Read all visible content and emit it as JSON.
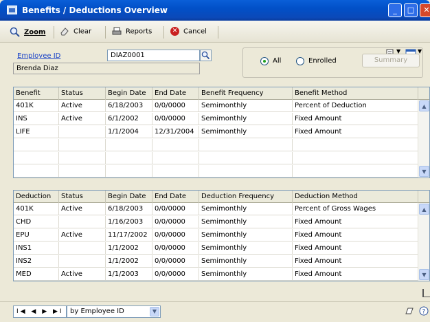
{
  "window": {
    "title": "Benefits / Deductions Overview",
    "buttons": [
      "_",
      "□",
      "✕"
    ]
  },
  "toolbar": {
    "zoom": "Zoom",
    "clear": "Clear",
    "reports": "Reports",
    "cancel": "Cancel"
  },
  "employee": {
    "label": "Employee ID",
    "id": "DIAZ0001",
    "name": "Brenda Diaz"
  },
  "filter": {
    "all": "All",
    "enrolled": "Enrolled",
    "selected": "All",
    "summary": "Summary"
  },
  "benefits": {
    "columns": [
      "Benefit",
      "Status",
      "Begin Date",
      "End Date",
      "Benefit Frequency",
      "Benefit Method"
    ],
    "rows": [
      [
        "401K",
        "Active",
        "6/18/2003",
        "0/0/0000",
        "Semimonthly",
        "Percent of Deduction"
      ],
      [
        "INS",
        "Active",
        "6/1/2002",
        "0/0/0000",
        "Semimonthly",
        "Fixed Amount"
      ],
      [
        "LIFE",
        "",
        "1/1/2004",
        "12/31/2004",
        "Semimonthly",
        "Fixed Amount"
      ],
      [
        "",
        "",
        "",
        "",
        "",
        ""
      ],
      [
        "",
        "",
        "",
        "",
        "",
        ""
      ],
      [
        "",
        "",
        "",
        "",
        "",
        ""
      ]
    ]
  },
  "deductions": {
    "columns": [
      "Deduction",
      "Status",
      "Begin Date",
      "End Date",
      "Deduction Frequency",
      "Deduction Method"
    ],
    "rows": [
      [
        "401K",
        "Active",
        "6/18/2003",
        "0/0/0000",
        "Semimonthly",
        "Percent of Gross Wages"
      ],
      [
        "CHD",
        "",
        "1/16/2003",
        "0/0/0000",
        "Semimonthly",
        "Fixed Amount"
      ],
      [
        "EPU",
        "Active",
        "11/17/2002",
        "0/0/0000",
        "Semimonthly",
        "Fixed Amount"
      ],
      [
        "INS1",
        "",
        "1/1/2002",
        "0/0/0000",
        "Semimonthly",
        "Fixed Amount"
      ],
      [
        "INS2",
        "",
        "1/1/2002",
        "0/0/0000",
        "Semimonthly",
        "Fixed Amount"
      ],
      [
        "MED",
        "Active",
        "1/1/2003",
        "0/0/0000",
        "Semimonthly",
        "Fixed Amount"
      ]
    ]
  },
  "navigation": {
    "buttons": "I◀ ◀ ▶ ▶I",
    "sort": "by Employee ID"
  }
}
